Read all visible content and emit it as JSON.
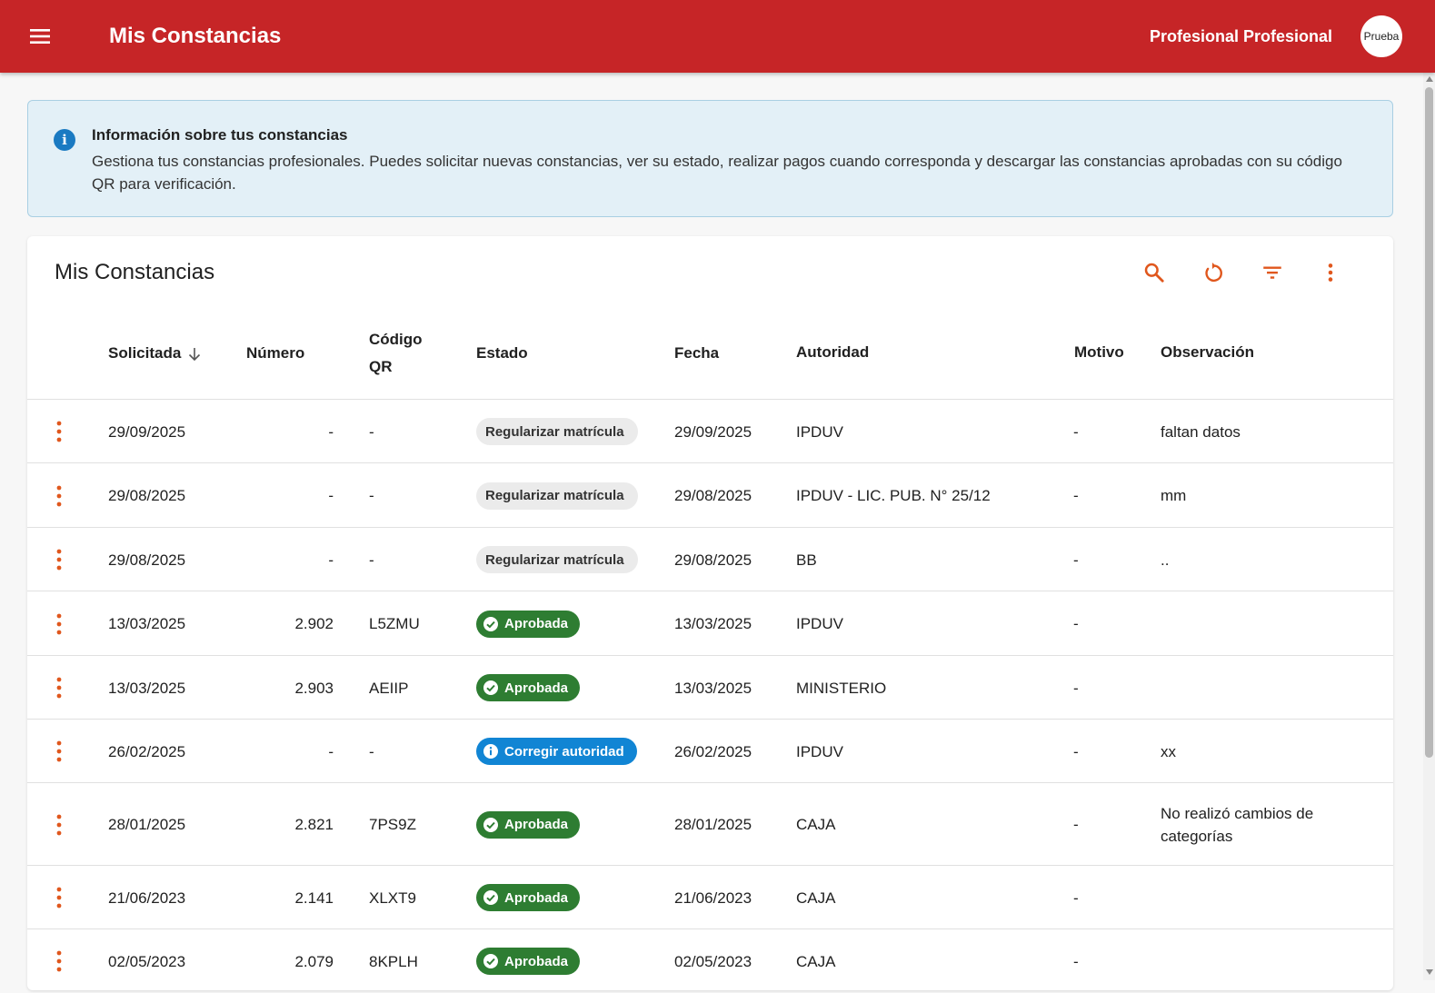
{
  "header": {
    "title": "Mis Constancias",
    "user_name": "Profesional Profesional",
    "avatar_text": "Prueba"
  },
  "info": {
    "title": "Información sobre tus constancias",
    "text": "Gestiona tus constancias profesionales. Puedes solicitar nuevas constancias, ver su estado, realizar pagos cuando corresponda y descargar las constancias aprobadas con su código QR para verificación."
  },
  "card": {
    "title": "Mis Constancias"
  },
  "toolbar_icons": [
    "search-icon",
    "refresh-icon",
    "filter-icon",
    "more-vert-icon"
  ],
  "colors": {
    "app_bar": "#c62527",
    "accent": "#e0571d",
    "approved": "#2e7d32",
    "info": "#1185d4",
    "pending_chip": "#ebebeb"
  },
  "table": {
    "columns": {
      "solicitada": "Solicitada",
      "numero": "Número",
      "codigo_qr_1": "Código",
      "codigo_qr_2": "QR",
      "estado": "Estado",
      "fecha": "Fecha",
      "autoridad": "Autoridad",
      "motivo": "Motivo",
      "observacion": "Observación"
    },
    "rows": [
      {
        "solicitada": "29/09/2025",
        "numero": "-",
        "qr": "-",
        "estado": "Regularizar matrícula",
        "estado_type": "grey",
        "fecha": "29/09/2025",
        "autoridad": "IPDUV",
        "motivo": "-",
        "observacion": "faltan datos"
      },
      {
        "solicitada": "29/08/2025",
        "numero": "-",
        "qr": "-",
        "estado": "Regularizar matrícula",
        "estado_type": "grey",
        "fecha": "29/08/2025",
        "autoridad": "IPDUV - LIC. PUB. N° 25/12",
        "motivo": "-",
        "observacion": "mm"
      },
      {
        "solicitada": "29/08/2025",
        "numero": "-",
        "qr": "-",
        "estado": "Regularizar matrícula",
        "estado_type": "grey",
        "fecha": "29/08/2025",
        "autoridad": "BB",
        "motivo": "-",
        "observacion": ".."
      },
      {
        "solicitada": "13/03/2025",
        "numero": "2.902",
        "qr": "L5ZMU",
        "estado": "Aprobada",
        "estado_type": "green",
        "fecha": "13/03/2025",
        "autoridad": "IPDUV",
        "motivo": "-",
        "observacion": ""
      },
      {
        "solicitada": "13/03/2025",
        "numero": "2.903",
        "qr": "AEIIP",
        "estado": "Aprobada",
        "estado_type": "green",
        "fecha": "13/03/2025",
        "autoridad": "MINISTERIO",
        "motivo": "-",
        "observacion": ""
      },
      {
        "solicitada": "26/02/2025",
        "numero": "-",
        "qr": "-",
        "estado": "Corregir autoridad",
        "estado_type": "blue",
        "fecha": "26/02/2025",
        "autoridad": "IPDUV",
        "motivo": "-",
        "observacion": "xx"
      },
      {
        "solicitada": "28/01/2025",
        "numero": "2.821",
        "qr": "7PS9Z",
        "estado": "Aprobada",
        "estado_type": "green",
        "fecha": "28/01/2025",
        "autoridad": "CAJA",
        "motivo": "-",
        "observacion": "No realizó cambios de",
        "observacion_2": "categorías"
      },
      {
        "solicitada": "21/06/2023",
        "numero": "2.141",
        "qr": "XLXT9",
        "estado": "Aprobada",
        "estado_type": "green",
        "fecha": "21/06/2023",
        "autoridad": "CAJA",
        "motivo": "-",
        "observacion": ""
      },
      {
        "solicitada": "02/05/2023",
        "numero": "2.079",
        "qr": "8KPLH",
        "estado": "Aprobada",
        "estado_type": "green",
        "fecha": "02/05/2023",
        "autoridad": "CAJA",
        "motivo": "-",
        "observacion": ""
      }
    ]
  }
}
